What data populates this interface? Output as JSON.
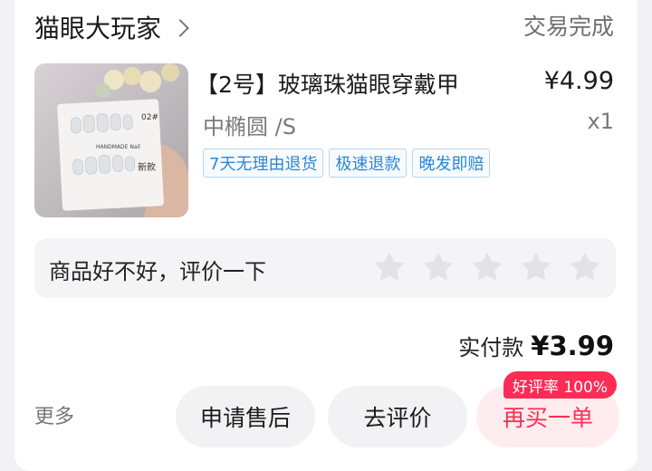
{
  "order": {
    "shop_name": "猫眼大玩家",
    "status": "交易完成",
    "product": {
      "title": "【2号】玻璃珠猫眼穿戴甲",
      "price": "¥4.99",
      "spec": "中椭圆 /S",
      "quantity": "x1",
      "tags": [
        "7天无理由退货",
        "极速退款",
        "晚发即赔"
      ],
      "image_text": [
        "02#",
        "HANDMADE Nail",
        "新款"
      ]
    },
    "review": {
      "prompt": "商品好不好，评价一下",
      "stars_total": 5,
      "stars_selected": 0
    },
    "payment": {
      "label": "实付款",
      "amount": "¥3.99"
    },
    "actions": {
      "more": "更多",
      "after_sales": "申请售后",
      "review": "去评价",
      "rebuy": "再买一单",
      "rebuy_badge": "好评率 100%"
    }
  },
  "colors": {
    "accent": "#fe2c55",
    "tag_blue": "#2c86d4",
    "muted_text": "#7a7a7a"
  }
}
